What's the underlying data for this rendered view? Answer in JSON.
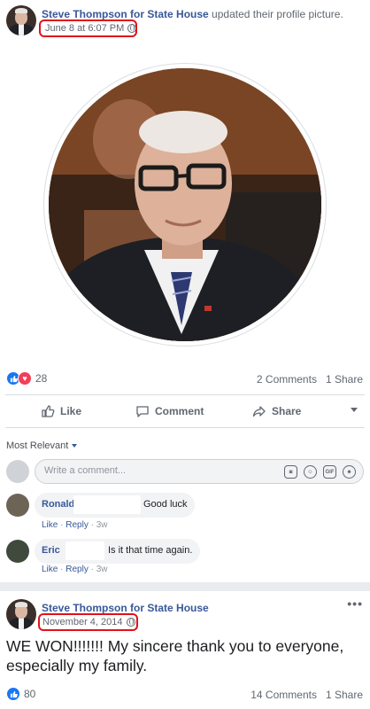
{
  "post1": {
    "author": "Steve Thompson for State House",
    "action": "updated their profile picture.",
    "timestamp": "June 8 at 6:07 PM",
    "reaction_count": "28",
    "comments_count": "2 Comments",
    "shares_count": "1 Share",
    "actions": {
      "like": "Like",
      "comment": "Comment",
      "share": "Share"
    }
  },
  "comments_section": {
    "sort_label": "Most Relevant",
    "composer_placeholder": "Write a comment...",
    "comments": [
      {
        "name": "Ronald",
        "text": "Good luck",
        "like": "Like",
        "reply": "Reply",
        "age": "3w"
      },
      {
        "name": "Eric",
        "text": "Is it that time again.",
        "like": "Like",
        "reply": "Reply",
        "age": "3w"
      }
    ]
  },
  "post2": {
    "author": "Steve Thompson for State House",
    "timestamp": "November 4, 2014",
    "text": "WE WON!!!!!!! My sincere thank you to everyone, especially my family.",
    "reaction_count": "80",
    "comments_count": "14 Comments",
    "shares_count": "1 Share"
  },
  "icons": [
    "globe-icon",
    "like-reaction-icon",
    "love-reaction-icon",
    "thumbs-up-icon",
    "comment-icon",
    "share-icon",
    "camera-icon",
    "smiley-icon",
    "gif-icon",
    "sticker-icon",
    "more-icon"
  ],
  "colors": {
    "link": "#385898",
    "highlight": "#e0121b",
    "like": "#1877f2",
    "love": "#f33e58"
  }
}
